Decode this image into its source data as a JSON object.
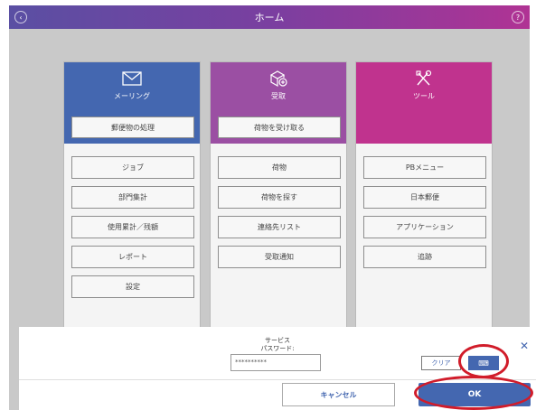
{
  "window": {
    "title": "ホーム"
  },
  "columns": [
    {
      "title": "メーリング",
      "icon": "envelope-icon",
      "color": "#4467b0",
      "primary": "郵便物の処理",
      "items": [
        "ジョブ",
        "部門集計",
        "使用累計／残額",
        "レポート",
        "設定"
      ]
    },
    {
      "title": "受取",
      "icon": "package-receive-icon",
      "color": "#9b4fa3",
      "primary": "荷物を受け取る",
      "items": [
        "荷物",
        "荷物を探す",
        "連絡先リスト",
        "受取通知"
      ]
    },
    {
      "title": "ツール",
      "icon": "tools-icon",
      "color": "#c0338e",
      "items": [
        "PBメニュー",
        "日本郵便",
        "アプリケーション",
        "追跡"
      ]
    }
  ],
  "dialog": {
    "label_line1": "サービス",
    "label_line2": "パスワード:",
    "password_value": "**********",
    "clear_label": "クリア",
    "keyboard_icon": "keyboard-icon",
    "cancel_label": "キャンセル",
    "ok_label": "OK",
    "close_icon": "close-icon",
    "highlight_color": "#d11c2a"
  }
}
